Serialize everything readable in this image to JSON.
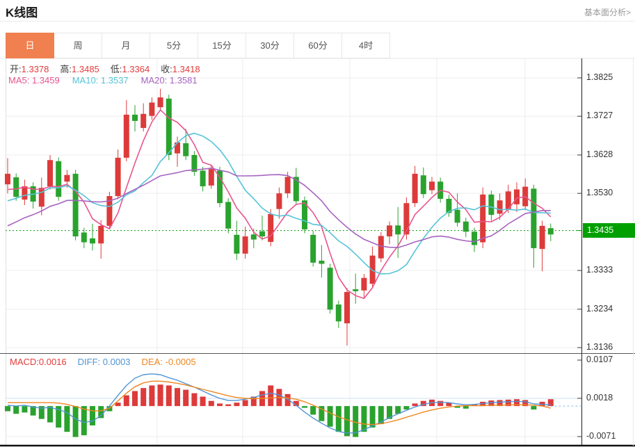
{
  "header": {
    "title": "K线图",
    "link": "基本面分析>"
  },
  "tabs": {
    "items": [
      "日",
      "周",
      "月",
      "5分",
      "15分",
      "30分",
      "60分",
      "4时"
    ],
    "active_index": 0
  },
  "info": {
    "open_label": "开:",
    "open_value": "1.3378",
    "high_label": "高:",
    "high_value": "1.3485",
    "low_label": "低:",
    "low_value": "1.3364",
    "close_label": "收:",
    "close_value": "1.3418",
    "ma5_text": "MA5: 1.3459",
    "ma10_text": "MA10: 1.3537",
    "ma20_text": "MA20: 1.3581"
  },
  "macd_info": {
    "macd_text": "MACD:0.0016",
    "diff_text": "DIFF: 0.0003",
    "dea_text": "DEA: -0.0005"
  },
  "colors": {
    "up": "#dd3a3a",
    "down": "#2aa22e",
    "value_red": "#e23b3b",
    "ma5": "#e8548e",
    "ma10": "#55c3d9",
    "ma20": "#a663c0",
    "diff": "#4f94d4",
    "dea": "#f0861f",
    "tag_green": "#00a000",
    "tab_active": "#f08050",
    "current_line": "#009900",
    "grid": "#ececec",
    "axis": "#3a3a3a"
  },
  "chart_data": {
    "type": "candlestick",
    "title": "K线图",
    "legend": [
      "MA5",
      "MA10",
      "MA20",
      "MACD",
      "DIFF",
      "DEA"
    ],
    "price_ticks": [
      {
        "label": "1.3825",
        "value": 1.3825
      },
      {
        "label": "1.3727",
        "value": 1.3727
      },
      {
        "label": "1.3628",
        "value": 1.3628
      },
      {
        "label": "1.3530",
        "value": 1.353
      },
      {
        "label": "1.3333",
        "value": 1.3333
      },
      {
        "label": "1.3234",
        "value": 1.3234
      },
      {
        "label": "1.3136",
        "value": 1.3136
      }
    ],
    "current_price": {
      "label": "1.3435",
      "value": 1.3435
    },
    "price_range": [
      1.3136,
      1.3825
    ],
    "vertical_gridlines_x": [
      226,
      349,
      503,
      628,
      755
    ],
    "ma_periods": [
      5,
      10,
      20
    ],
    "prehistory_closes": [
      1.331,
      1.332,
      1.3335,
      1.335,
      1.336,
      1.3375,
      1.339,
      1.3405,
      1.3418,
      1.3432,
      1.3445,
      1.3458,
      1.347,
      1.3482,
      1.3494,
      1.3505,
      1.3515,
      1.3525,
      1.3535,
      1.3545
    ],
    "candles": [
      [
        1.3553,
        1.362,
        1.353,
        1.358
      ],
      [
        1.3571,
        1.3581,
        1.3511,
        1.3521
      ],
      [
        1.3514,
        1.3565,
        1.35,
        1.3548
      ],
      [
        1.3548,
        1.3558,
        1.3491,
        1.3509
      ],
      [
        1.3496,
        1.357,
        1.3474,
        1.3544
      ],
      [
        1.3548,
        1.3628,
        1.354,
        1.3615
      ],
      [
        1.3612,
        1.3622,
        1.3511,
        1.3521
      ],
      [
        1.356,
        1.359,
        1.3545,
        1.3577
      ],
      [
        1.358,
        1.359,
        1.341,
        1.342
      ],
      [
        1.343,
        1.3442,
        1.339,
        1.3405
      ],
      [
        1.3415,
        1.3452,
        1.3384,
        1.3402
      ],
      [
        1.3402,
        1.3462,
        1.3363,
        1.3447
      ],
      [
        1.3447,
        1.3534,
        1.3438,
        1.3523
      ],
      [
        1.3523,
        1.3642,
        1.3515,
        1.3621
      ],
      [
        1.3621,
        1.3768,
        1.3612,
        1.3731
      ],
      [
        1.3731,
        1.3755,
        1.3688,
        1.3715
      ],
      [
        1.3697,
        1.376,
        1.3688,
        1.3733
      ],
      [
        1.3728,
        1.3775,
        1.3718,
        1.3762
      ],
      [
        1.375,
        1.3797,
        1.374,
        1.3775
      ],
      [
        1.3772,
        1.3782,
        1.3615,
        1.3628
      ],
      [
        1.3632,
        1.3675,
        1.3598,
        1.366
      ],
      [
        1.3658,
        1.3695,
        1.3615,
        1.3625
      ],
      [
        1.3628,
        1.3638,
        1.3575,
        1.3585
      ],
      [
        1.3588,
        1.3598,
        1.3535,
        1.3548
      ],
      [
        1.355,
        1.3602,
        1.3542,
        1.3592
      ],
      [
        1.3588,
        1.3598,
        1.3495,
        1.3505
      ],
      [
        1.3508,
        1.3518,
        1.3428,
        1.344
      ],
      [
        1.3424,
        1.346,
        1.336,
        1.3376
      ],
      [
        1.3376,
        1.3445,
        1.3363,
        1.342
      ],
      [
        1.3425,
        1.344,
        1.339,
        1.3412
      ],
      [
        1.3433,
        1.3473,
        1.341,
        1.342
      ],
      [
        1.3406,
        1.349,
        1.3395,
        1.3477
      ],
      [
        1.349,
        1.3545,
        1.3465,
        1.353
      ],
      [
        1.353,
        1.3585,
        1.3518,
        1.3572
      ],
      [
        1.3572,
        1.3595,
        1.35,
        1.351
      ],
      [
        1.3512,
        1.3522,
        1.3428,
        1.3438
      ],
      [
        1.3424,
        1.3434,
        1.3343,
        1.3353
      ],
      [
        1.3358,
        1.3398,
        1.3315,
        1.335
      ],
      [
        1.334,
        1.335,
        1.3223,
        1.3233
      ],
      [
        1.3246,
        1.3256,
        1.3186,
        1.3203
      ],
      [
        1.3198,
        1.3288,
        1.3141,
        1.3278
      ],
      [
        1.3285,
        1.3325,
        1.3248,
        1.328
      ],
      [
        1.3282,
        1.3324,
        1.3262,
        1.3314
      ],
      [
        1.3299,
        1.3394,
        1.3289,
        1.3371
      ],
      [
        1.3364,
        1.3431,
        1.3354,
        1.3421
      ],
      [
        1.342,
        1.3458,
        1.34,
        1.3448
      ],
      [
        1.3448,
        1.3495,
        1.3365,
        1.3425
      ],
      [
        1.3425,
        1.352,
        1.3412,
        1.3505
      ],
      [
        1.3505,
        1.36,
        1.3495,
        1.358
      ],
      [
        1.3576,
        1.3596,
        1.3518,
        1.3528
      ],
      [
        1.3538,
        1.3572,
        1.3528,
        1.356
      ],
      [
        1.356,
        1.357,
        1.3506,
        1.3516
      ],
      [
        1.3516,
        1.3526,
        1.347,
        1.348
      ],
      [
        1.3488,
        1.353,
        1.3445,
        1.3455
      ],
      [
        1.3458,
        1.3468,
        1.3418,
        1.3432
      ],
      [
        1.3432,
        1.3442,
        1.338,
        1.3398
      ],
      [
        1.3405,
        1.3545,
        1.339,
        1.3527
      ],
      [
        1.3527,
        1.3537,
        1.346,
        1.3475
      ],
      [
        1.3478,
        1.353,
        1.3462,
        1.3512
      ],
      [
        1.349,
        1.3552,
        1.348,
        1.3535
      ],
      [
        1.3502,
        1.3558,
        1.3482,
        1.354
      ],
      [
        1.3497,
        1.3568,
        1.3487,
        1.3547
      ],
      [
        1.3542,
        1.3552,
        1.334,
        1.339
      ],
      [
        1.3388,
        1.346,
        1.3331,
        1.3447
      ],
      [
        1.3441,
        1.3453,
        1.3408,
        1.3425
      ]
    ],
    "macd": {
      "ticks": [
        {
          "label": "0.0107",
          "value": 0.0107
        },
        {
          "label": "0.0018",
          "value": 0.0018
        },
        {
          "label": "-0.0071",
          "value": -0.0071
        }
      ],
      "hist": [
        -0.0012,
        -0.0018,
        -0.0015,
        -0.0022,
        -0.003,
        -0.0038,
        -0.005,
        -0.006,
        -0.0072,
        -0.0068,
        -0.0045,
        -0.0028,
        -0.0012,
        0.0008,
        0.0025,
        0.0035,
        0.0042,
        0.0048,
        0.005,
        0.0048,
        0.0042,
        0.0038,
        0.003,
        0.0022,
        0.0012,
        0.0006,
        0.0004,
        0.0008,
        0.0014,
        0.0022,
        0.0035,
        0.0048,
        0.004,
        0.0028,
        0.0012,
        -0.0004,
        -0.002,
        -0.0035,
        -0.0048,
        -0.006,
        -0.007,
        -0.0072,
        -0.006,
        -0.005,
        -0.0042,
        -0.003,
        -0.0018,
        -0.0008,
        0.0006,
        0.0012,
        0.0015,
        0.0012,
        0.0008,
        -0.0004,
        -0.0006,
        0.0004,
        0.001,
        0.0013,
        0.0014,
        0.0015,
        0.0016,
        0.0014,
        -0.0008,
        0.001,
        0.0016
      ],
      "diff": [
        0.0002,
        0.0,
        0.0002,
        -0.0002,
        -0.0005,
        -0.0003,
        -0.0008,
        -0.0015,
        -0.003,
        -0.0038,
        -0.0035,
        -0.0022,
        0.0,
        0.0025,
        0.0048,
        0.0065,
        0.0073,
        0.0075,
        0.0073,
        0.0066,
        0.006,
        0.0052,
        0.0044,
        0.0035,
        0.0026,
        0.0018,
        0.0013,
        0.0013,
        0.0016,
        0.002,
        0.0026,
        0.003,
        0.0026,
        0.0016,
        0.0002,
        -0.0014,
        -0.0028,
        -0.004,
        -0.0051,
        -0.0059,
        -0.0063,
        -0.0062,
        -0.0055,
        -0.0046,
        -0.0037,
        -0.0027,
        -0.0018,
        -0.001,
        -0.0002,
        0.0004,
        0.0008,
        0.0009,
        0.0008,
        0.0005,
        0.0003,
        0.0004,
        0.0006,
        0.0008,
        0.0009,
        0.001,
        0.0011,
        0.001,
        0.0005,
        0.0004,
        0.0003
      ],
      "dea": [
        0.0008,
        0.0008,
        0.0008,
        0.0008,
        0.0008,
        0.0008,
        0.0007,
        0.0004,
        -0.0001,
        -0.0007,
        -0.0011,
        -0.0011,
        -0.0005,
        0.0012,
        0.003,
        0.0045,
        0.0054,
        0.0058,
        0.0058,
        0.0056,
        0.0053,
        0.0049,
        0.0044,
        0.0039,
        0.0034,
        0.0029,
        0.0024,
        0.002,
        0.0018,
        0.0017,
        0.0018,
        0.0019,
        0.002,
        0.0019,
        0.0016,
        0.001,
        0.0002,
        -0.0007,
        -0.0016,
        -0.0025,
        -0.0032,
        -0.0038,
        -0.0042,
        -0.0043,
        -0.0041,
        -0.0037,
        -0.0032,
        -0.0026,
        -0.002,
        -0.0014,
        -0.0009,
        -0.0005,
        -0.0002,
        0.0,
        0.0001,
        0.0001,
        0.0001,
        0.0002,
        0.0002,
        0.0003,
        0.0003,
        0.0003,
        0.0002,
        0.0,
        -0.0005
      ]
    }
  }
}
